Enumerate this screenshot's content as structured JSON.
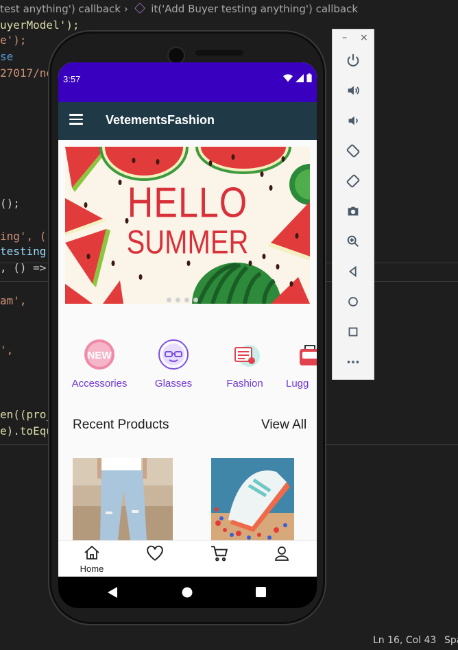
{
  "editor": {
    "breadcrumb_left": "test anything') callback",
    "breadcrumb_right": "it('Add Buyer testing anything') callback",
    "code_lines": [
      {
        "text": "uyerModel');",
        "color": "#dcdcaa"
      },
      {
        "text": "e');",
        "color": "#ce9178"
      },
      {
        "text": "se",
        "color": "#569cd6"
      },
      {
        "text": "27017/ne",
        "color": "#ce9178"
      },
      {
        "text": "();",
        "color": "#d4d4d4"
      },
      {
        "text": "ing', ()",
        "color": "#ce9178"
      },
      {
        "text": "testing",
        "color": "#9cdcfe"
      },
      {
        "text": ", () =>",
        "color": "#d4d4d4"
      },
      {
        "text": "am',",
        "color": "#ce9178"
      },
      {
        "text": "',",
        "color": "#ce9178"
      },
      {
        "text": "en((pro_",
        "color": "#dcdcaa"
      },
      {
        "text": "e).toEqu",
        "color": "#dcdcaa"
      }
    ],
    "status_position": "Ln 16, Col 43",
    "status_spaces": "Spa"
  },
  "emulator_panel": {
    "minimize": "–",
    "close": "×"
  },
  "phone": {
    "status_time": "3:57",
    "app_title": "VetementsFashion",
    "banner": {
      "line1": "HELLO",
      "line2": "SUMMER",
      "slide_count": 4
    },
    "categories": [
      {
        "label": "Accessories",
        "icon": "new-badge-icon"
      },
      {
        "label": "Glasses",
        "icon": "glasses-icon"
      },
      {
        "label": "Fashion",
        "icon": "fashion-icon"
      },
      {
        "label": "Lugg",
        "icon": "luggage-icon"
      }
    ],
    "section_title": "Recent Products",
    "view_all": "View All",
    "bottom_nav": [
      {
        "label": "Home",
        "icon": "home-icon"
      },
      {
        "label": "",
        "icon": "heart-icon"
      },
      {
        "label": "",
        "icon": "cart-icon"
      },
      {
        "label": "",
        "icon": "user-icon"
      }
    ],
    "colors": {
      "status_bar": "#3a00c0",
      "app_bar": "#1f3a46",
      "accent": "#6c35d8"
    }
  }
}
